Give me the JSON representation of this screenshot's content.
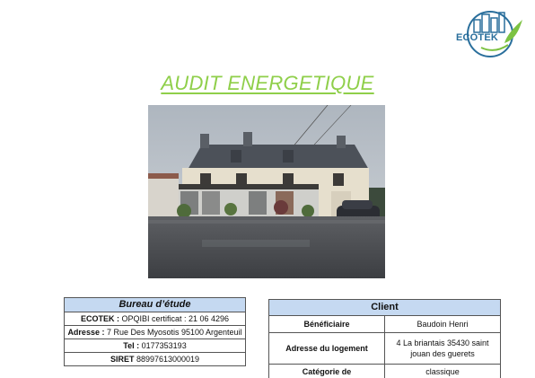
{
  "logo": {
    "text": "ECOTEK",
    "colors": {
      "brand_blue": "#2a6f9c",
      "brand_green": "#7cc242"
    }
  },
  "title": "AUDIT ENERGETIQUE",
  "photo": {
    "subject": "house-photo"
  },
  "bureau": {
    "header": "Bureau d’étude",
    "rows": [
      {
        "label": "ECOTEK :",
        "value": " OPQIBI certificat : 21 06 4296"
      },
      {
        "label": "Adresse :",
        "value": " 7 Rue Des Myosotis 95100 Argenteuil"
      },
      {
        "label": "Tel :",
        "value": " 0177353193"
      },
      {
        "label": "SIRET",
        "value": " 88997613000019"
      }
    ]
  },
  "client": {
    "header": "Client",
    "rows": [
      {
        "label": "Bénéficiaire",
        "value": "Baudoin Henri"
      },
      {
        "label": "Adresse du logement",
        "value": "4 La briantais 35430 saint jouan des guerets"
      },
      {
        "label": "Catégorie de",
        "value": "classique"
      }
    ]
  },
  "colors": {
    "title_green": "#8fcf4a",
    "table_header_bg": "#c5d9f1"
  }
}
